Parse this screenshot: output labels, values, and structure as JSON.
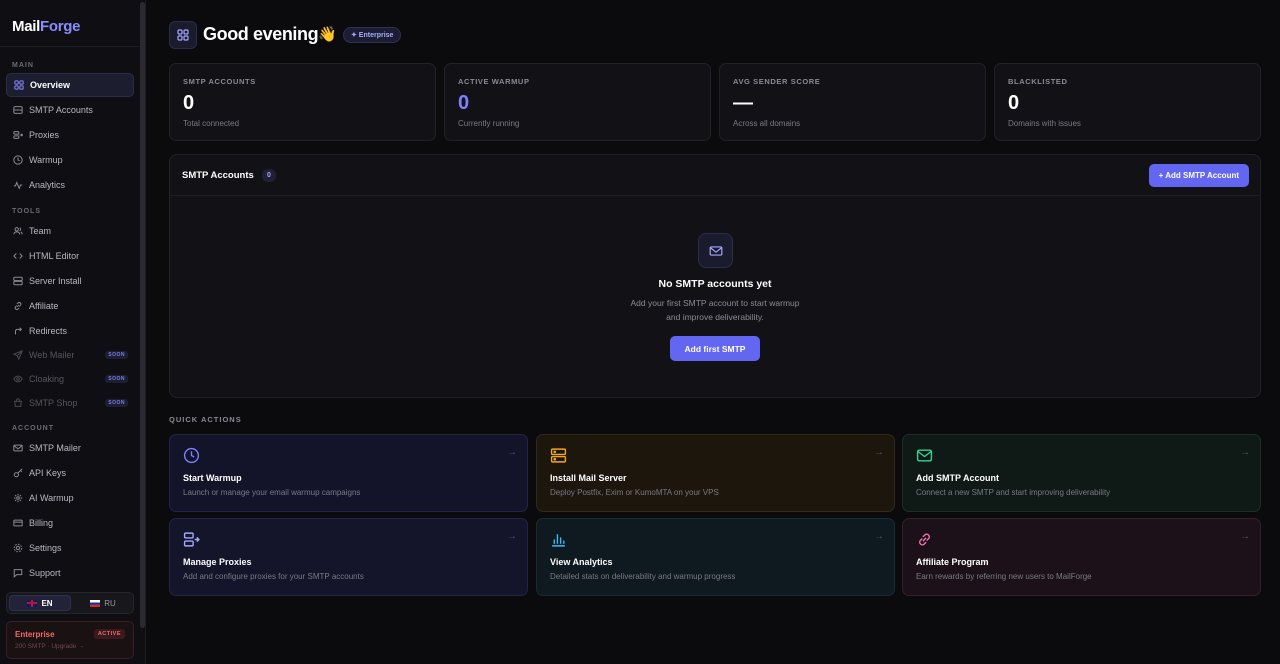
{
  "app": {
    "logo_main": "Mail",
    "logo_accent": "Forge"
  },
  "sidebar": {
    "sections": {
      "main": "MAIN",
      "tools": "TOOLS",
      "account": "ACCOUNT"
    },
    "main_items": [
      {
        "label": "Overview",
        "icon": "grid-icon"
      },
      {
        "label": "SMTP Accounts",
        "icon": "server-icon"
      },
      {
        "label": "Proxies",
        "icon": "proxy-icon"
      },
      {
        "label": "Warmup",
        "icon": "clock-icon"
      },
      {
        "label": "Analytics",
        "icon": "activity-icon"
      }
    ],
    "tools_items": [
      {
        "label": "Team",
        "icon": "users-icon"
      },
      {
        "label": "HTML Editor",
        "icon": "code-icon"
      },
      {
        "label": "Server Install",
        "icon": "database-icon"
      },
      {
        "label": "Affiliate",
        "icon": "link-icon"
      },
      {
        "label": "Redirects",
        "icon": "redirect-icon"
      },
      {
        "label": "Web Mailer",
        "icon": "send-icon",
        "badge": "SOON"
      },
      {
        "label": "Cloaking",
        "icon": "eye-icon",
        "badge": "SOON"
      },
      {
        "label": "SMTP Shop",
        "icon": "shop-icon",
        "badge": "SOON"
      }
    ],
    "account_items": [
      {
        "label": "SMTP Mailer",
        "icon": "mail-icon"
      },
      {
        "label": "API Keys",
        "icon": "key-icon"
      },
      {
        "label": "AI Warmup",
        "icon": "sparkle-icon"
      },
      {
        "label": "Billing",
        "icon": "card-icon"
      },
      {
        "label": "Settings",
        "icon": "gear-icon"
      },
      {
        "label": "Support",
        "icon": "chat-icon"
      }
    ],
    "lang": {
      "en": "EN",
      "ru": "RU"
    },
    "plan": {
      "name": "Enterprise",
      "badge": "ACTIVE",
      "sub": "200 SMTP · Upgrade →"
    }
  },
  "header": {
    "greeting": "Good evening",
    "wave": "👋",
    "tier": "✦ Enterprise"
  },
  "stats": [
    {
      "label": "SMTP ACCOUNTS",
      "value": "0",
      "sub": "Total connected"
    },
    {
      "label": "ACTIVE WARMUP",
      "value": "0",
      "sub": "Currently running"
    },
    {
      "label": "AVG SENDER SCORE",
      "value": "—",
      "sub": "Across all domains"
    },
    {
      "label": "BLACKLISTED",
      "value": "0",
      "sub": "Domains with issues"
    }
  ],
  "smtp_panel": {
    "title": "SMTP Accounts",
    "count": "0",
    "add_button": "+ Add SMTP Account",
    "empty_title": "No SMTP accounts yet",
    "empty_line1": "Add your first SMTP account to start warmup",
    "empty_line2": "and improve deliverability.",
    "empty_button": "Add first SMTP"
  },
  "quick_actions": {
    "label": "QUICK ACTIONS",
    "arrow": "→",
    "items": [
      {
        "title": "Start Warmup",
        "desc": "Launch or manage your email warmup campaigns",
        "icon": "clock-icon",
        "color": "#7d80ff"
      },
      {
        "title": "Install Mail Server",
        "desc": "Deploy Postfix, Exim or KumoMTA on your VPS",
        "icon": "server-icon",
        "color": "#f5a524"
      },
      {
        "title": "Add SMTP Account",
        "desc": "Connect a new SMTP and start improving deliverability",
        "icon": "mail-icon",
        "color": "#34d399"
      },
      {
        "title": "Manage Proxies",
        "desc": "Add and configure proxies for your SMTP accounts",
        "icon": "proxy-icon",
        "color": "#a5a7ff"
      },
      {
        "title": "View Analytics",
        "desc": "Detailed stats on deliverability and warmup progress",
        "icon": "bar-chart-icon",
        "color": "#38bdf8"
      },
      {
        "title": "Affiliate Program",
        "desc": "Earn rewards by referring new users to MailForge",
        "icon": "link-icon",
        "color": "#f472b6"
      }
    ]
  }
}
